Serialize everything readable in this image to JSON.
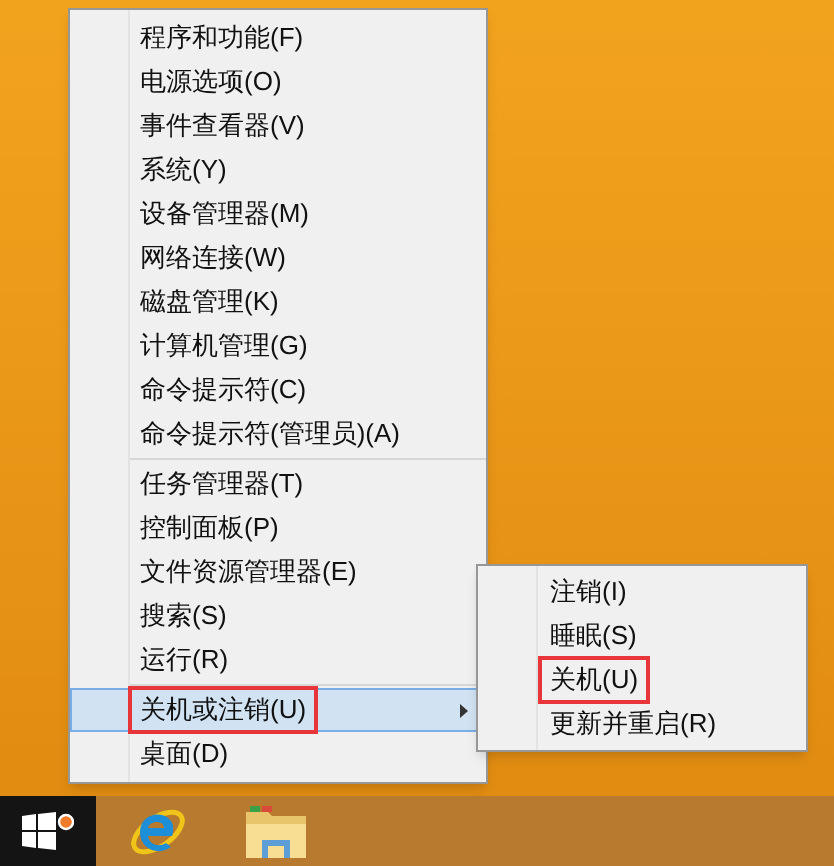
{
  "menu": {
    "groups": [
      {
        "items": [
          {
            "label": "程序和功能(F)",
            "kind": "command",
            "selected": false,
            "annotated": false
          },
          {
            "label": "电源选项(O)",
            "kind": "command",
            "selected": false,
            "annotated": false
          },
          {
            "label": "事件查看器(V)",
            "kind": "command",
            "selected": false,
            "annotated": false
          },
          {
            "label": "系统(Y)",
            "kind": "command",
            "selected": false,
            "annotated": false
          },
          {
            "label": "设备管理器(M)",
            "kind": "command",
            "selected": false,
            "annotated": false
          },
          {
            "label": "网络连接(W)",
            "kind": "command",
            "selected": false,
            "annotated": false
          },
          {
            "label": "磁盘管理(K)",
            "kind": "command",
            "selected": false,
            "annotated": false
          },
          {
            "label": "计算机管理(G)",
            "kind": "command",
            "selected": false,
            "annotated": false
          },
          {
            "label": "命令提示符(C)",
            "kind": "command",
            "selected": false,
            "annotated": false
          },
          {
            "label": "命令提示符(管理员)(A)",
            "kind": "command",
            "selected": false,
            "annotated": false
          }
        ]
      },
      {
        "items": [
          {
            "label": "任务管理器(T)",
            "kind": "command",
            "selected": false,
            "annotated": false
          },
          {
            "label": "控制面板(P)",
            "kind": "command",
            "selected": false,
            "annotated": false
          },
          {
            "label": "文件资源管理器(E)",
            "kind": "command",
            "selected": false,
            "annotated": false
          },
          {
            "label": "搜索(S)",
            "kind": "command",
            "selected": false,
            "annotated": false
          },
          {
            "label": "运行(R)",
            "kind": "command",
            "selected": false,
            "annotated": false
          }
        ]
      },
      {
        "items": [
          {
            "label": "关机或注销(U)",
            "kind": "submenu",
            "selected": true,
            "annotated": true
          },
          {
            "label": "桌面(D)",
            "kind": "command",
            "selected": false,
            "annotated": false
          }
        ]
      }
    ]
  },
  "submenu": {
    "items": [
      {
        "label": "注销(I)",
        "selected": false,
        "annotated": false
      },
      {
        "label": "睡眠(S)",
        "selected": false,
        "annotated": false
      },
      {
        "label": "关机(U)",
        "selected": false,
        "annotated": true
      },
      {
        "label": "更新并重启(R)",
        "selected": false,
        "annotated": false
      }
    ]
  }
}
